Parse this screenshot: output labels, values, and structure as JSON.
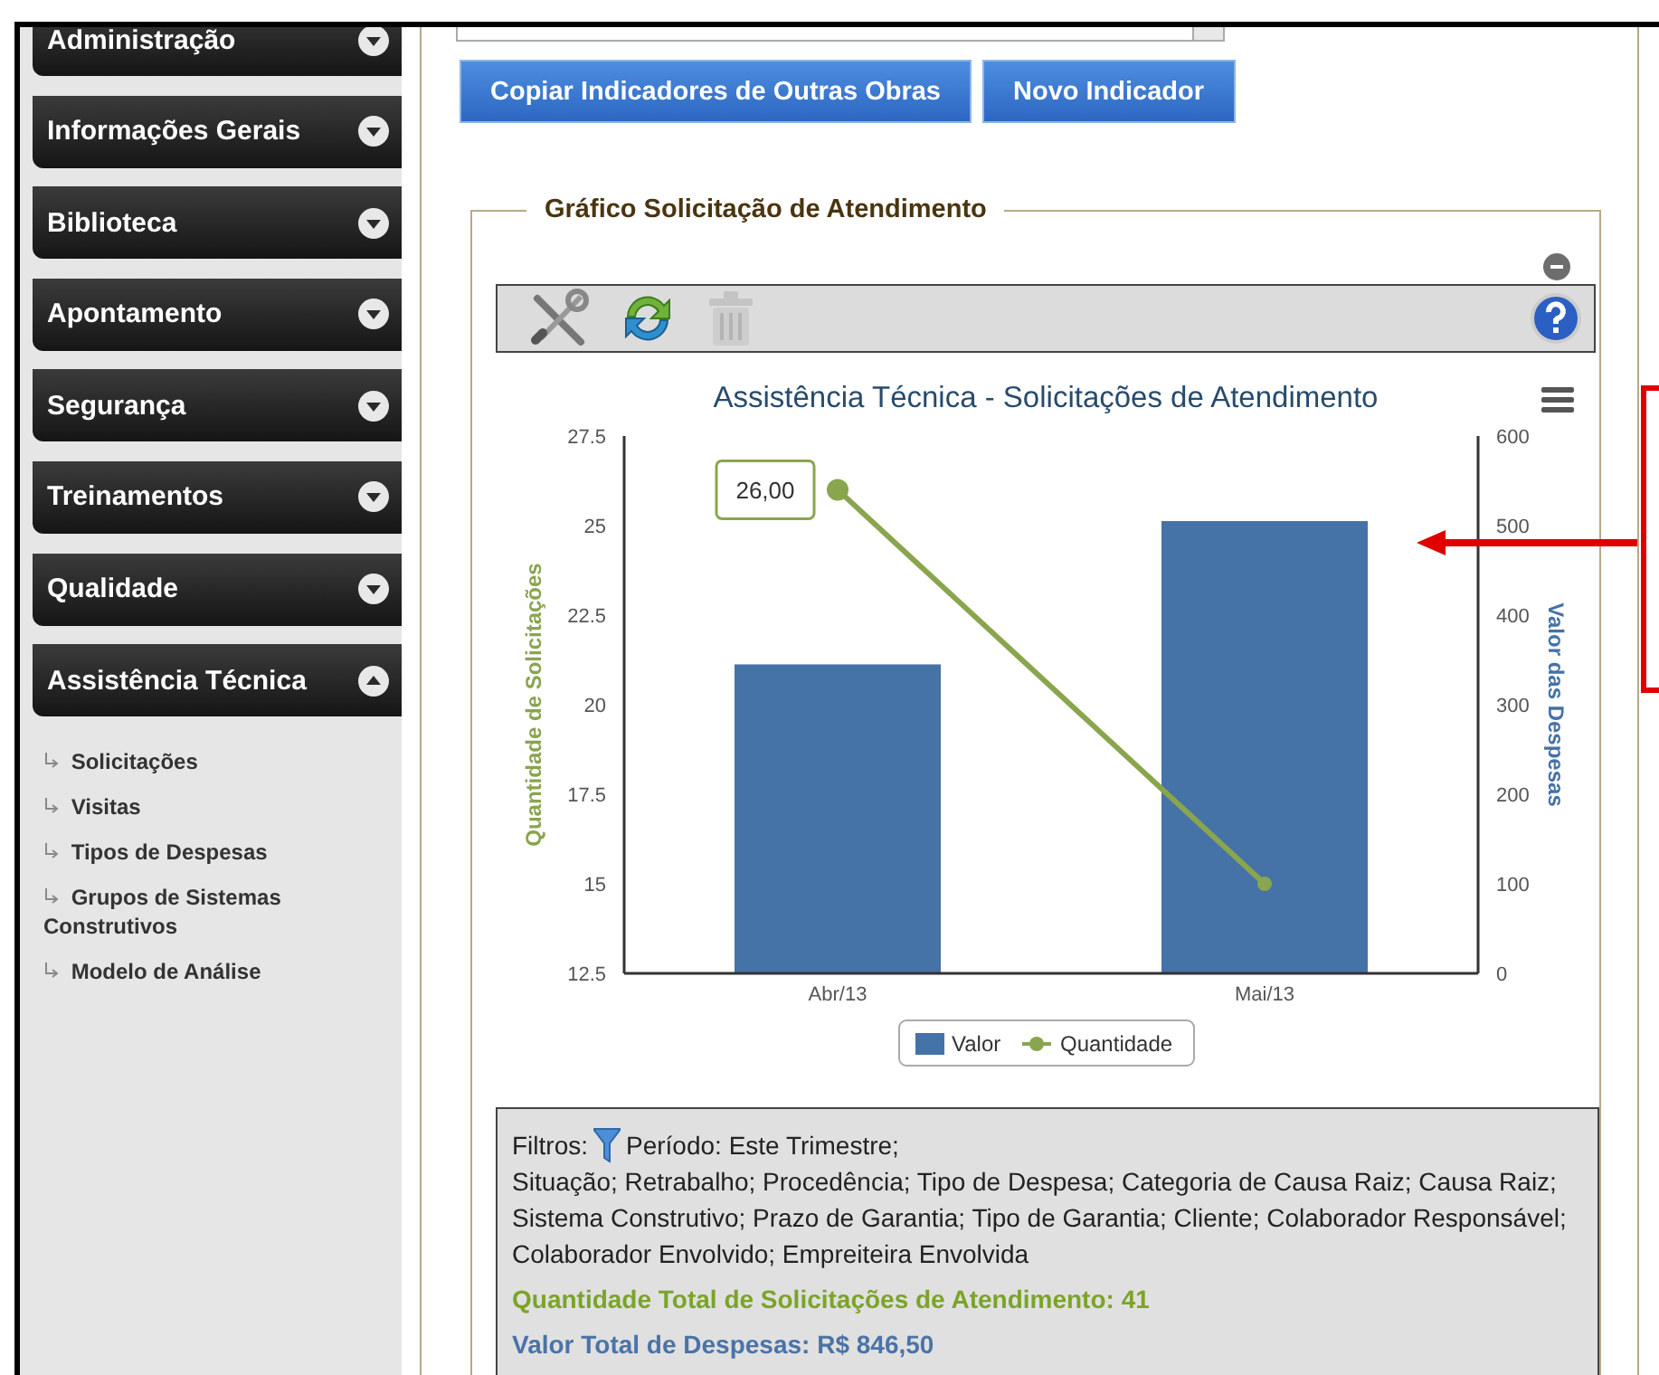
{
  "sidebar": {
    "menus": [
      {
        "label": "Administração",
        "expanded": false
      },
      {
        "label": "Informações Gerais",
        "expanded": false
      },
      {
        "label": "Biblioteca",
        "expanded": false
      },
      {
        "label": "Apontamento",
        "expanded": false
      },
      {
        "label": "Segurança",
        "expanded": false
      },
      {
        "label": "Treinamentos",
        "expanded": false
      },
      {
        "label": "Qualidade",
        "expanded": false
      },
      {
        "label": "Assistência Técnica",
        "expanded": true,
        "children": [
          {
            "label": "Solicitações"
          },
          {
            "label": "Visitas"
          },
          {
            "label": "Tipos de Despesas"
          },
          {
            "label": "Grupos de Sistemas Construtivos"
          },
          {
            "label": "Modelo de Análise"
          }
        ]
      }
    ]
  },
  "buttons": [
    "Copiar Indicadores de Outras Obras",
    "Novo Indicador"
  ],
  "panel": {
    "legend": "Gráfico Solicitação de Atendimento",
    "toolbar": [
      {
        "kind": "settings",
        "disabled": false
      },
      {
        "kind": "refresh",
        "disabled": false
      },
      {
        "kind": "delete",
        "disabled": true
      },
      {
        "kind": "help",
        "disabled": false
      }
    ],
    "chart": {
      "chart_data": {
        "type": "bar",
        "title": "Assistência Técnica - Solicitações de Atendimento",
        "categories": [
          "Abr/13",
          "Mai/13"
        ],
        "series": [
          {
            "name": "Valor",
            "color": "#4572a7",
            "values": [
              345,
              505
            ],
            "axis": "y2"
          },
          {
            "name": "Quantidade",
            "color": "#89a54e",
            "values": [
              26,
              15
            ],
            "type": "line",
            "marker": "circle"
          }
        ],
        "legend": "bottom",
        "ylabel": "Quantidade de Solicitações",
        "y2label": "Valor das Despesas",
        "ylim": [
          12.5,
          27.5
        ],
        "yticks": [
          12.5,
          15,
          17.5,
          20,
          22.5,
          25,
          27.5
        ],
        "y2lim": [
          0,
          600
        ],
        "y2ticks": [
          0,
          100,
          200,
          300,
          400,
          500,
          600
        ],
        "annotations": [
          {
            "x": "Abr/13",
            "y": 26,
            "text": "26,00"
          }
        ]
      }
    },
    "filters": {
      "label": "Filtros:",
      "period": "Período: Este Trimestre;",
      "list": "Situação; Retrabalho; Procedência; Tipo de Despesa; Categoria de Causa Raiz; Causa Raiz; Sistema Construtivo; Prazo de Garantia; Tipo de Garantia; Cliente; Colaborador Responsável; Colaborador Envolvido; Empreiteira Envolvida",
      "totals": [
        {
          "text": "Quantidade Total de Solicitações de Atendimento: 41",
          "color": "#7ba428"
        },
        {
          "text": "Valor Total de Despesas: R$ 846,50",
          "color": "#4a73a8"
        }
      ]
    }
  }
}
